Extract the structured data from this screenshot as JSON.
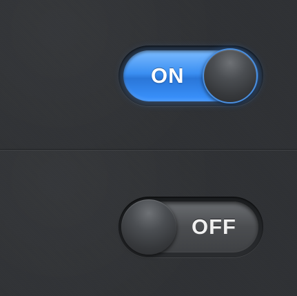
{
  "toggles": [
    {
      "label": "ON",
      "state": "on",
      "accent": "#3b8ff2"
    },
    {
      "label": "OFF",
      "state": "off",
      "accent": "#4b4d50"
    }
  ],
  "colors": {
    "background": "#2f3134",
    "divider": "#1d1f21",
    "knob": "#4b4e52"
  }
}
